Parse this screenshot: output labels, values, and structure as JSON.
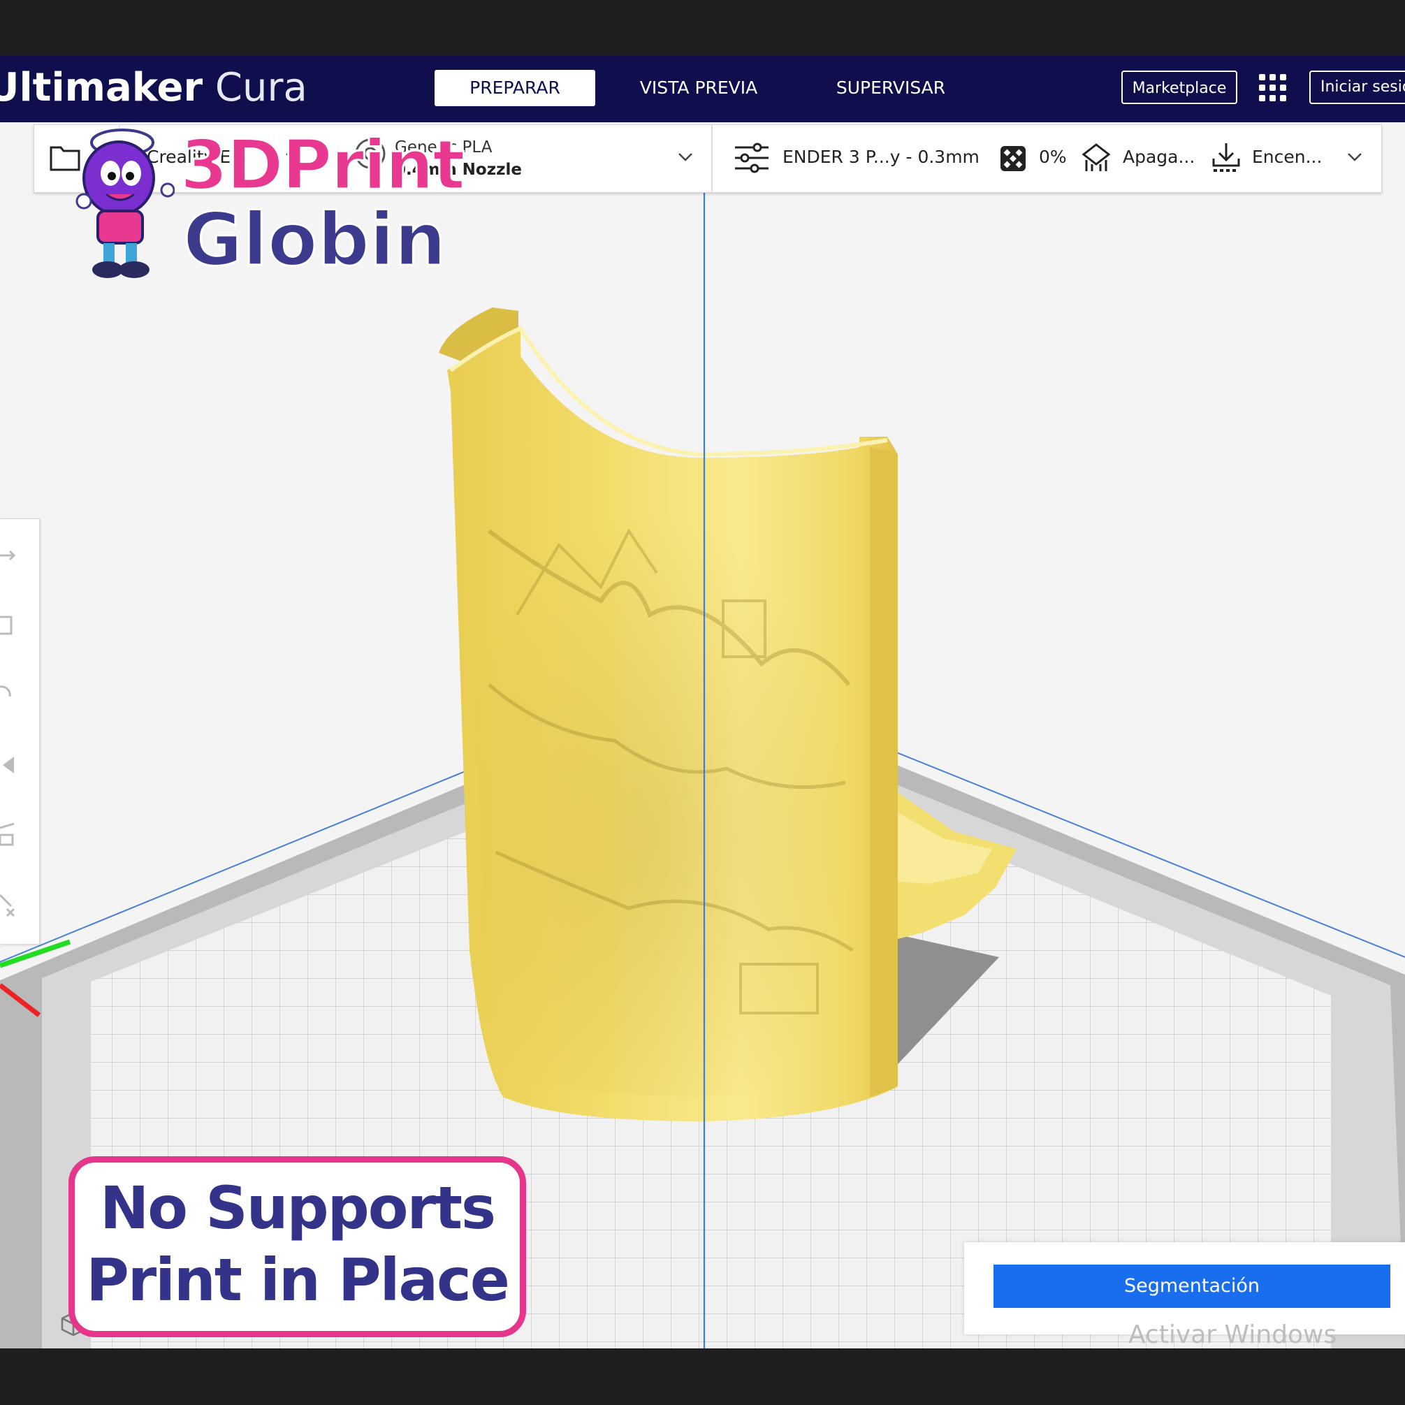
{
  "app": {
    "brand_bold": "Ultimaker",
    "brand_light": " Cura"
  },
  "nav": {
    "tabs": [
      {
        "label": "PREPARAR",
        "active": true
      },
      {
        "label": "VISTA PREVIA",
        "active": false
      },
      {
        "label": "SUPERVISAR",
        "active": false
      }
    ],
    "marketplace_label": "Marketplace",
    "signin_label": "Iniciar sesión"
  },
  "toolbar": {
    "printer": "Creality E…",
    "material": "Generic PLA",
    "nozzle": "0.4mm Nozzle",
    "profile": "ENDER 3 P...y - 0.3mm",
    "infill": "0%",
    "support": "Apaga...",
    "adhesion": "Encen..."
  },
  "slice": {
    "button_label": "Segmentación",
    "watermark": "Activar Windows"
  },
  "overlay": {
    "logo_line1": "3DPrint",
    "logo_line2": "Globin",
    "badge_line1": "No Supports",
    "badge_line2": "Print in Place"
  },
  "colors": {
    "header_bg": "#0f0f4d",
    "model_yellow": "#f5e27a",
    "slice_blue": "#196ef0",
    "badge_pink": "#e6368b",
    "badge_text": "#34338a"
  }
}
